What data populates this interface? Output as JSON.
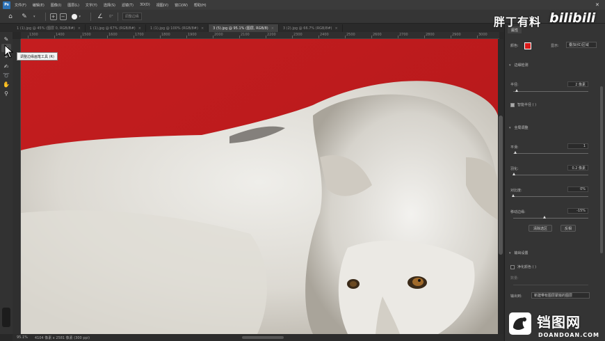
{
  "app": {
    "logo": "Ps",
    "menu": [
      "文件(F)",
      "编辑(E)",
      "图像(I)",
      "图层(L)",
      "文字(Y)",
      "选择(S)",
      "滤镜(T)",
      "3D(D)",
      "视图(V)",
      "窗口(W)",
      "帮助(H)"
    ]
  },
  "options": {
    "angle_label": "0°",
    "field_placeholder": "调整边缘"
  },
  "tabs": [
    {
      "label": "1 (1).jpg @ 45% (图层 0, RGB/8#)",
      "active": false
    },
    {
      "label": "1 (1).jpg @ 67% (RGB/8#)",
      "active": false
    },
    {
      "label": "1 (1).jpg @ 100% (RGB/8#)",
      "active": false
    },
    {
      "label": "3 (5).jpg @ 95.1% (图层, RGB/8)",
      "active": true
    },
    {
      "label": "3 (2).jpg @ 66.7% (RGB/8#)",
      "active": false
    }
  ],
  "ruler": [
    "1300",
    "1400",
    "1500",
    "1600",
    "1700",
    "1800",
    "1900",
    "2000",
    "2100",
    "2200",
    "2300",
    "2400",
    "2500",
    "2600",
    "2700",
    "2800",
    "2900",
    "3000"
  ],
  "tooltip": "调整边缘画笔工具 (R)",
  "status": {
    "zoom": "95.1%",
    "doc_info": "4104 像素 x 2581 像素 (300 ppi)"
  },
  "panel": {
    "tab_label": "属性",
    "color_label": "颜色:",
    "color_value": "#d91a1a",
    "display_label": "显示:",
    "display_value": "叠加(红)区域",
    "edge_detection": {
      "title": "边缘检测",
      "radius_label": "半径:",
      "radius_value": "2 像素",
      "radius_pos": 0.05,
      "smart_radius": "智能半径 ( )"
    },
    "global": {
      "title": "全局调整",
      "smooth_label": "平滑:",
      "smooth_value": "1",
      "smooth_pos": 0.03,
      "feather_label": "羽化:",
      "feather_value": "0.2 像素",
      "feather_pos": 0.01,
      "contrast_label": "对比度:",
      "contrast_value": "0%",
      "contrast_pos": 0.0,
      "shift_label": "移动边缘:",
      "shift_value": "-15%",
      "shift_pos": 0.42,
      "clear_btn": "清除选区",
      "invert_btn": "反相"
    },
    "output": {
      "title": "输出设置",
      "decontam": "净化颜色 ( )",
      "amount_label": "数量:",
      "output_to_label": "输出到:",
      "output_to_value": "新建带有图层蒙版的图层"
    }
  },
  "watermarks": {
    "top_cn": "胖丁有料",
    "top_bili": "bilibili",
    "bottom_cn": "铛图网",
    "bottom_en": "DOANDOAN.COM"
  }
}
